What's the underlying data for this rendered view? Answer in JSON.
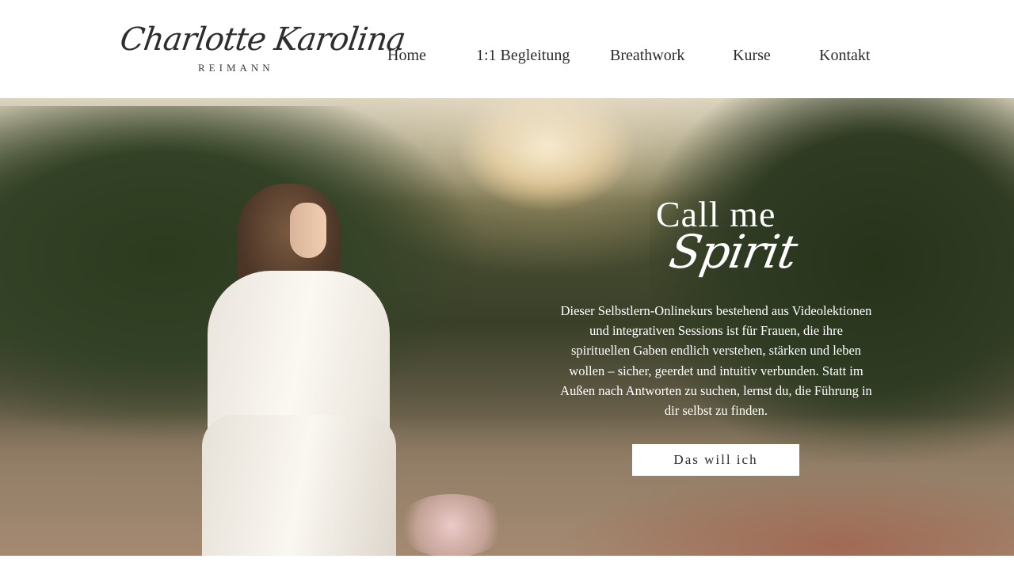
{
  "header": {
    "logo": {
      "script_text": "Charlotte Karolina",
      "sub_text": "REIMANN"
    },
    "nav": [
      {
        "label": "Home"
      },
      {
        "label": "1:1 Begleitung"
      },
      {
        "label": "Breathwork"
      },
      {
        "label": "Kurse"
      },
      {
        "label": "Kontakt"
      }
    ]
  },
  "hero": {
    "title_line1": "Call me",
    "title_line2": "Spirit",
    "description": "Dieser Selbstlern-Onlinekurs bestehend aus Videolektionen und integrativen Sessions ist für Frauen, die ihre spirituellen Gaben endlich verstehen, stärken und leben wollen – sicher, geerdet und intuitiv verbunden. Statt im Außen nach Antworten zu suchen, lernst du, die Führung in dir selbst zu finden.",
    "cta_label": "Das will ich",
    "image": "woman-in-white-dress-meadow-sunset"
  },
  "colors": {
    "background": "#ffffff",
    "text": "#2b2b2b",
    "hero_text": "#ffffff",
    "button_bg": "#ffffff"
  }
}
